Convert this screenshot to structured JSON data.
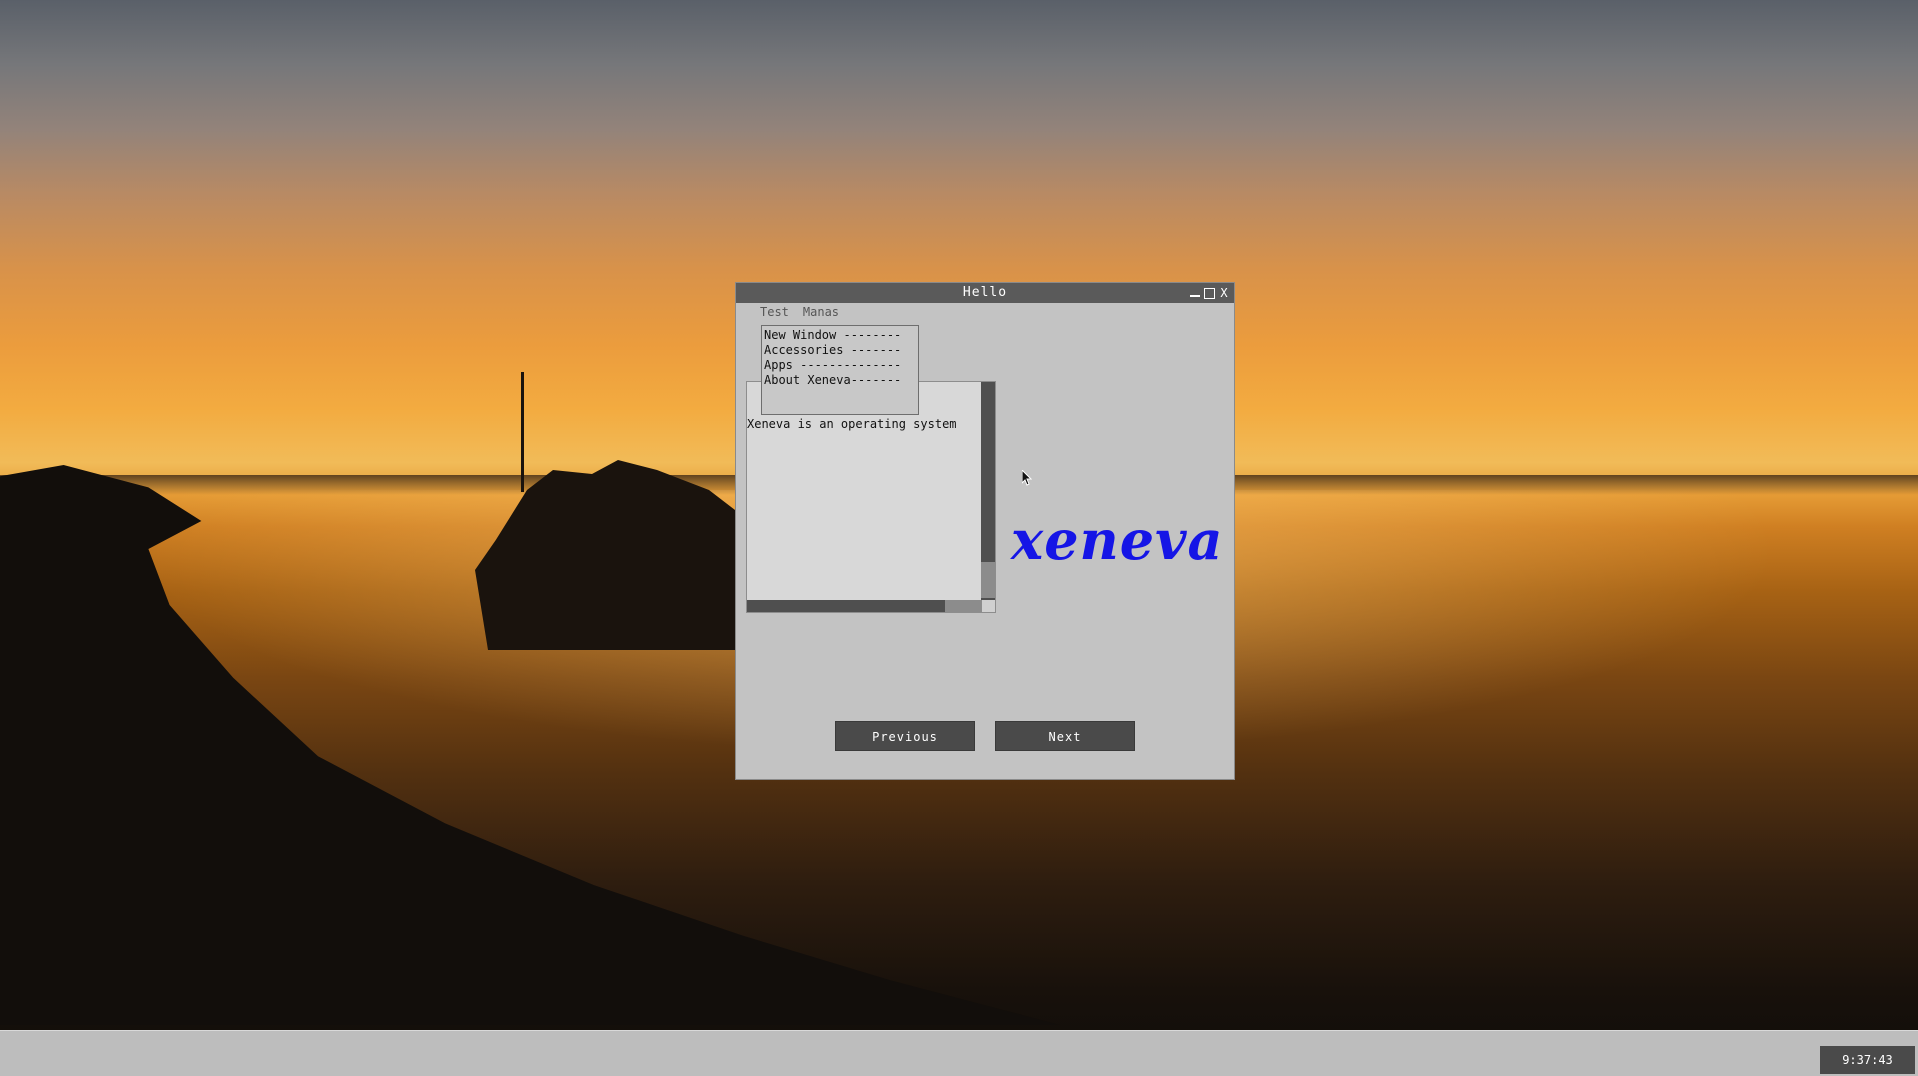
{
  "window": {
    "title": "Hello",
    "controls": {
      "minimize": "minimize-icon",
      "maximize": "maximize-icon",
      "close": "X"
    }
  },
  "menubar": {
    "items": [
      {
        "label": "Test"
      },
      {
        "label": "Manas"
      }
    ]
  },
  "dropdown": {
    "items": [
      {
        "label": "New Window --------"
      },
      {
        "label": "Accessories -------"
      },
      {
        "label": "Apps --------------"
      },
      {
        "label": "About Xeneva-------"
      }
    ]
  },
  "listbox": {
    "text": "Xeneva is an operating system"
  },
  "logo": {
    "text": "xeneva",
    "color": "#1515e6"
  },
  "buttons": {
    "previous": "Previous",
    "next": "Next"
  },
  "taskbar": {
    "clock": "9:37:43"
  }
}
